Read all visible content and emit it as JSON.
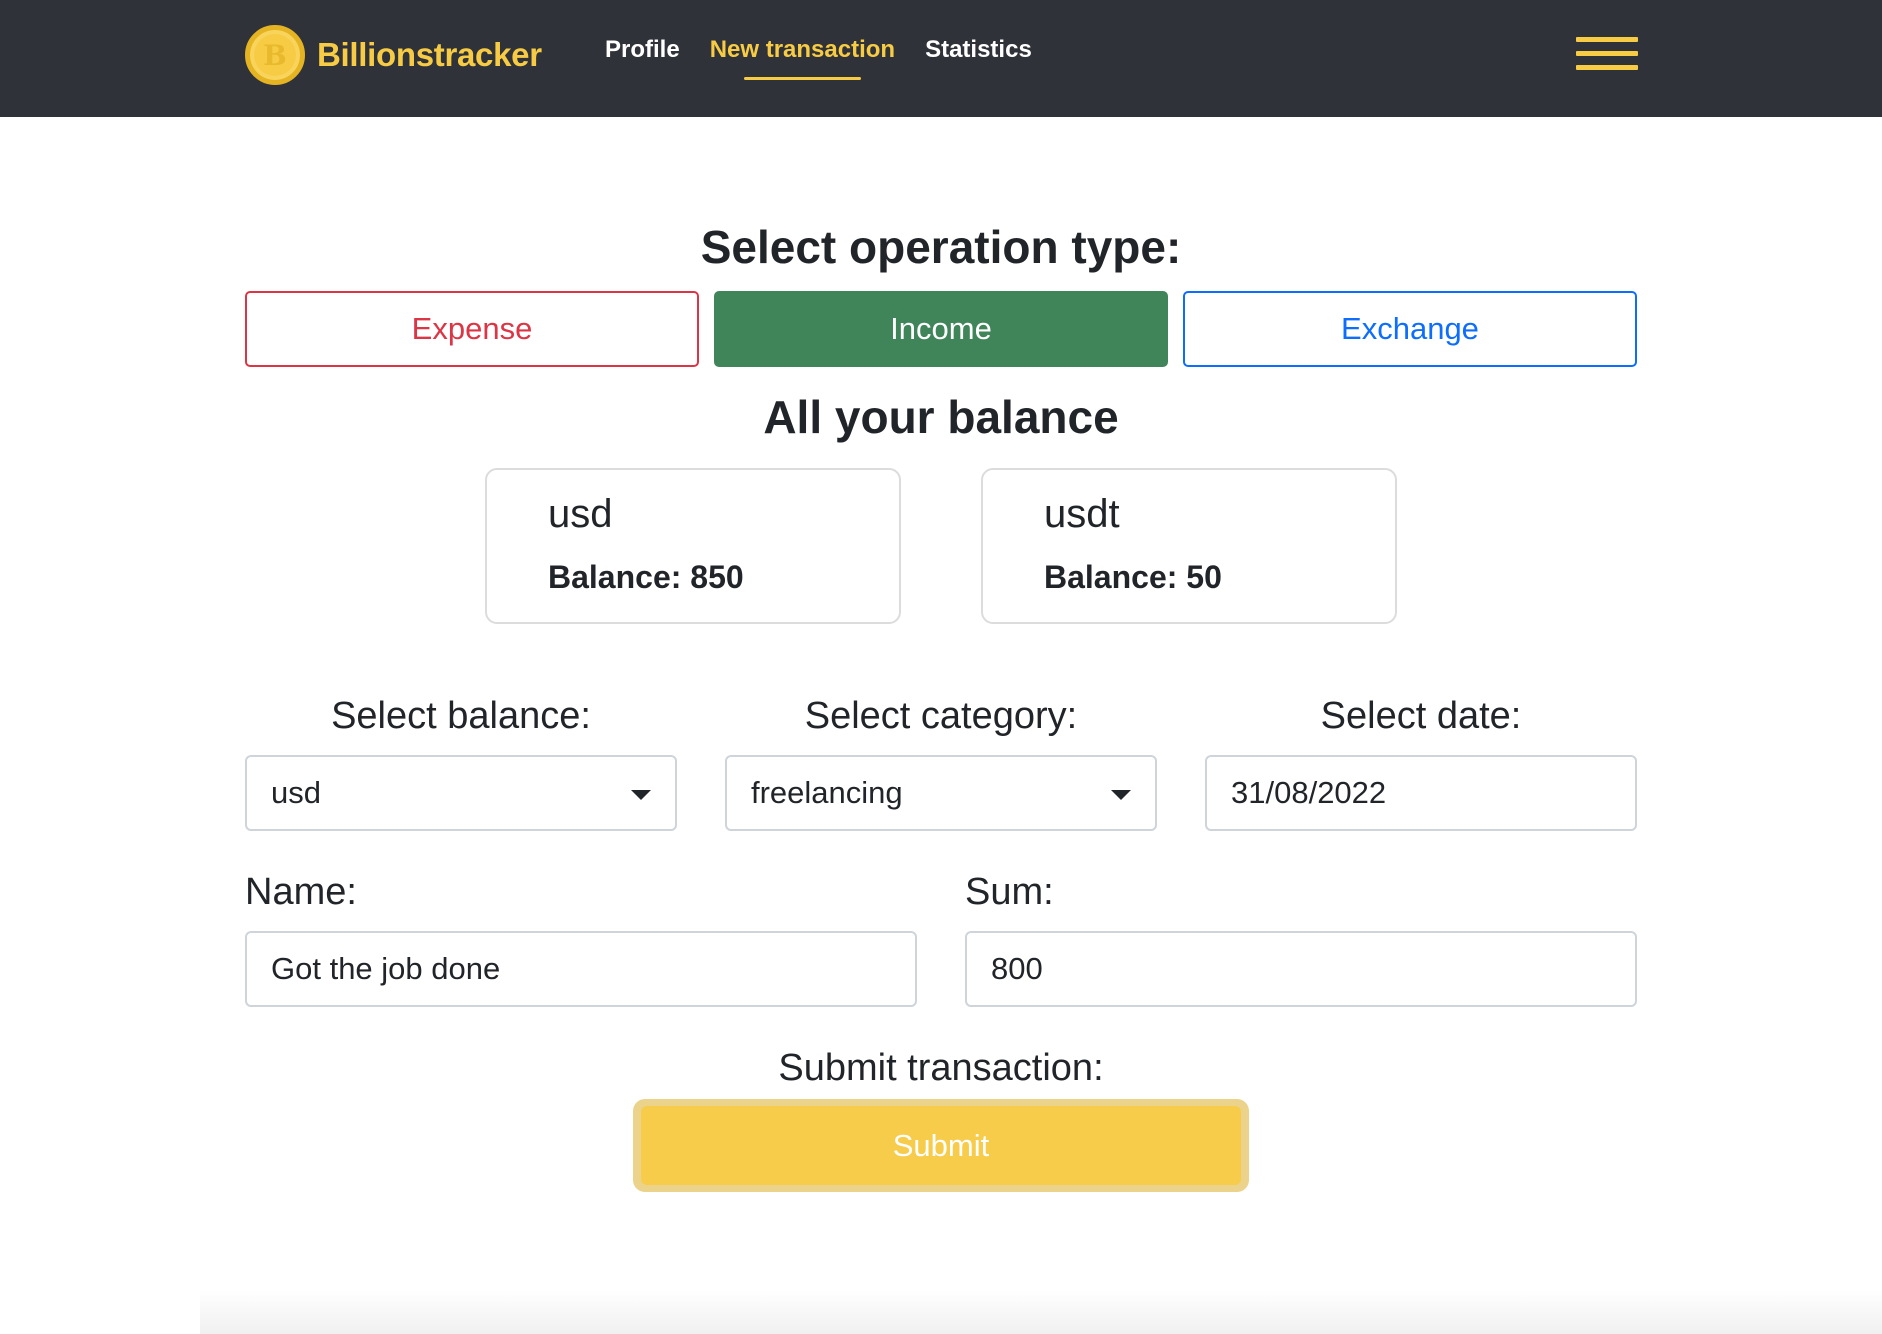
{
  "brand": {
    "name": "Billionstracker",
    "coin_letter": "B"
  },
  "nav": {
    "links": [
      {
        "label": "Profile"
      },
      {
        "label": "New transaction"
      },
      {
        "label": "Statistics"
      }
    ],
    "active": "New transaction"
  },
  "operation": {
    "heading": "Select operation type:",
    "buttons": {
      "expense": "Expense",
      "income": "Income",
      "exchange": "Exchange"
    },
    "selected": "Income"
  },
  "balances": {
    "heading": "All your balance",
    "items": [
      {
        "name": "usd",
        "balance_text": "Balance: 850"
      },
      {
        "name": "usdt",
        "balance_text": "Balance: 50"
      }
    ]
  },
  "form": {
    "balance_label": "Select balance:",
    "balance_value": "usd",
    "category_label": "Select category:",
    "category_value": "freelancing",
    "date_label": "Select date:",
    "date_value": "31/08/2022",
    "name_label": "Name:",
    "name_value": "Got the job done",
    "sum_label": "Sum:",
    "sum_value": "800",
    "submit_heading": "Submit transaction:",
    "submit_label": "Submit"
  },
  "colors": {
    "navbar": "#30323a",
    "accent": "#f7cc44",
    "expense": "#dc3545",
    "income": "#408459",
    "exchange": "#0d6efd"
  }
}
